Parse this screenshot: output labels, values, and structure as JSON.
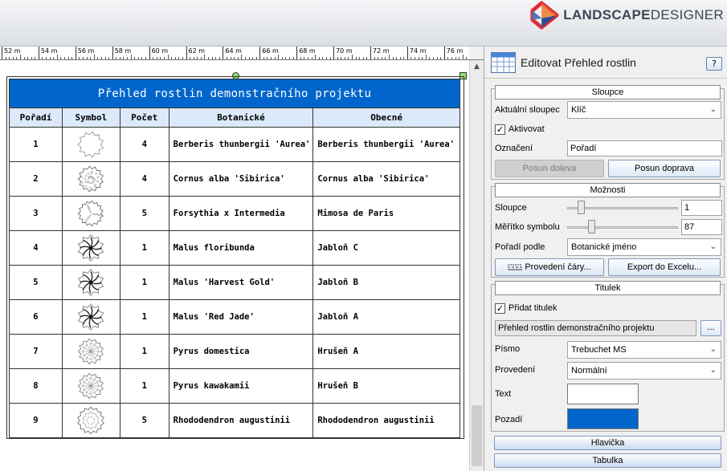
{
  "brand": {
    "name_bold": "LANDSCAPE",
    "name_light": "DESIGNER"
  },
  "ruler": {
    "labels": [
      "52 m",
      "54 m",
      "56 m",
      "58 m",
      "60 m",
      "62 m",
      "64 m",
      "66 m",
      "68 m",
      "70 m",
      "72 m",
      "74 m",
      "76 m"
    ]
  },
  "plant_table": {
    "title": "Přehled rostlin demonstračního projektu",
    "columns": [
      "Pořadí",
      "Symbol",
      "Počet",
      "Botanické",
      "Obecné"
    ],
    "rows": [
      {
        "order": "1",
        "count": "4",
        "botanical": "Berberis thunbergii 'Aurea'",
        "common": "Berberis thunbergii 'Aurea'",
        "symbol": "shrub-outline"
      },
      {
        "order": "2",
        "count": "4",
        "botanical": "Cornus alba 'Sibirica'",
        "common": "Cornus alba 'Sibirica'",
        "symbol": "shrub-dotted"
      },
      {
        "order": "3",
        "count": "5",
        "botanical": "Forsythia x Intermedia",
        "common": "Mimosa de Paris",
        "symbol": "shrub-textured"
      },
      {
        "order": "4",
        "count": "1",
        "botanical": "Malus floribunda",
        "common": "Jabloň C",
        "symbol": "tree-trunk"
      },
      {
        "order": "5",
        "count": "1",
        "botanical": "Malus 'Harvest Gold'",
        "common": "Jabloň B",
        "symbol": "tree-trunk"
      },
      {
        "order": "6",
        "count": "1",
        "botanical": "Malus 'Red Jade'",
        "common": "Jabloň A",
        "symbol": "tree-trunk"
      },
      {
        "order": "7",
        "count": "1",
        "botanical": "Pyrus domestica",
        "common": "Hrušeň A",
        "symbol": "tree-radial"
      },
      {
        "order": "8",
        "count": "1",
        "botanical": "Pyrus kawakamii",
        "common": "Hrušeň B",
        "symbol": "tree-radial"
      },
      {
        "order": "9",
        "count": "5",
        "botanical": "Rhododendron augustinii",
        "common": "Rhododendron augustinii",
        "symbol": "shrub-ring"
      }
    ]
  },
  "panel": {
    "title": "Editovat Přehled rostlin",
    "help_label": "?",
    "columns_group": {
      "header": "Sloupce",
      "current_column_label": "Aktuální sloupec",
      "current_column_value": "Klíč",
      "activated_label": "Aktivovat",
      "activated_checked": "✓",
      "designation_label": "Označení",
      "designation_value": "Pořadí",
      "move_left_label": "Posun doleva",
      "move_right_label": "Posun doprava"
    },
    "options_group": {
      "header": "Možnosti",
      "columns_label": "Sloupce",
      "columns_value": "1",
      "columns_slider_fraction": 0.12,
      "symbol_scale_label": "Měřítko symbolu",
      "symbol_scale_value": "87",
      "symbol_scale_slider_fraction": 0.22,
      "sort_by_label": "Pořadí podle",
      "sort_by_value": "Botanické jméno",
      "line_style_label": "Provedení čáry...",
      "export_label": "Export do Excelu..."
    },
    "title_group": {
      "header": "Titulek",
      "add_title_label": "Přidat titulek",
      "add_title_checked": "✓",
      "title_text": "Přehled rostlin demonstračního projektu",
      "browse_label": "...",
      "font_label": "Písmo",
      "font_value": "Trebuchet MS",
      "style_label": "Provedení",
      "style_value": "Normální",
      "text_color_label": "Text",
      "text_color": "#ffffff",
      "background_label": "Pozadí",
      "background_color": "#0066cc"
    },
    "header_button_label": "Hlavička",
    "table_button_label": "Tabulka"
  },
  "colors": {
    "title_bar": "#0066cc",
    "header_row": "#dbe9fb",
    "accent_border": "#7f98be"
  }
}
